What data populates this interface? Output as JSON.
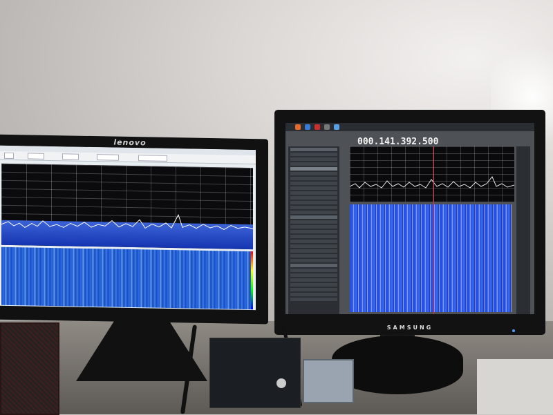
{
  "left_monitor": {
    "brand": "lenovo"
  },
  "right_monitor": {
    "brand": "SAMSUNG",
    "frequency_display": "000.141.392.500"
  },
  "colors": {
    "spectrum_fill": "#2a4fd0",
    "waterfall_blue": "#2a5ef0",
    "marker_red": "#e0303a"
  }
}
